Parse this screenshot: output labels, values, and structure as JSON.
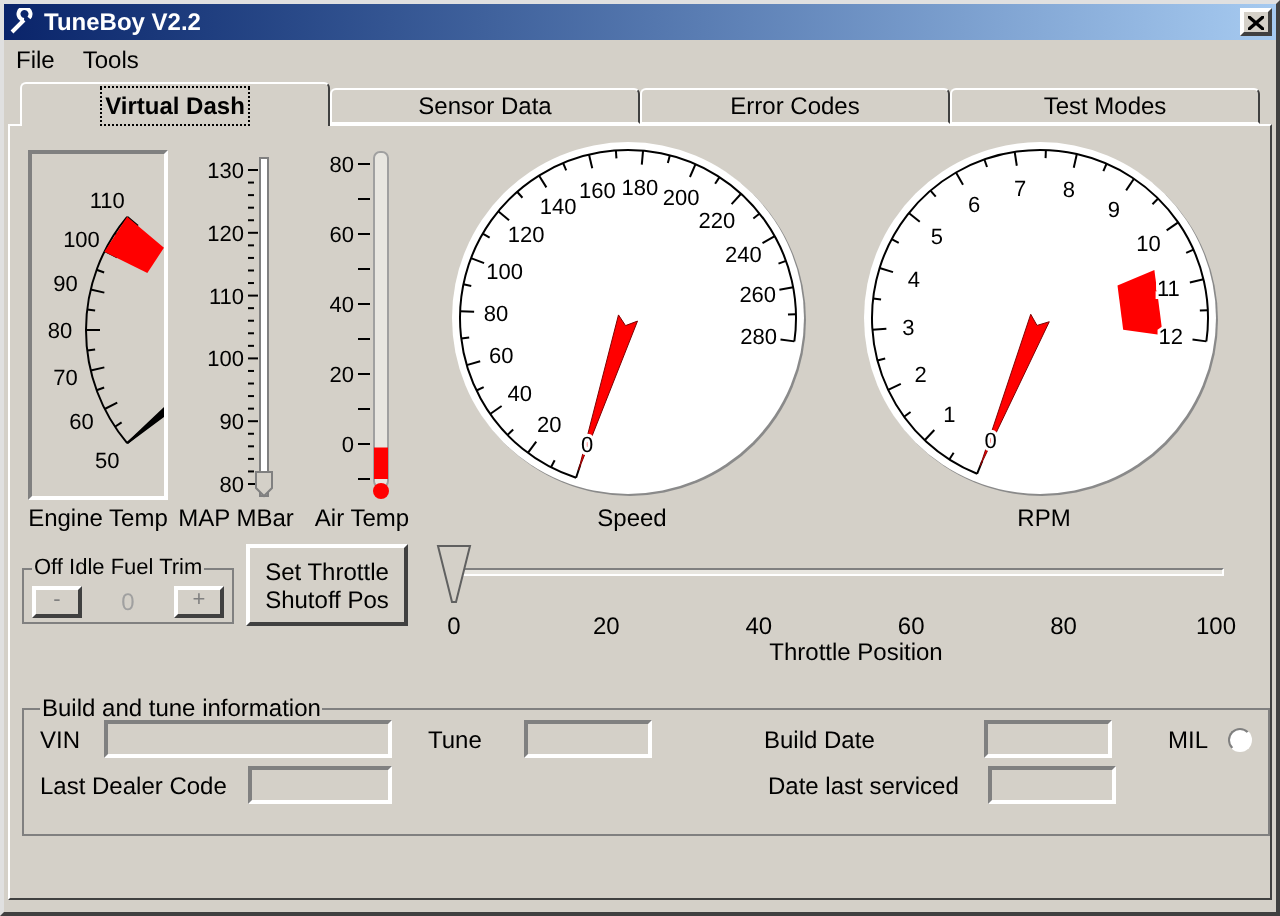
{
  "window": {
    "title": "TuneBoy V2.2"
  },
  "menu": [
    "File",
    "Tools"
  ],
  "tabs": [
    {
      "label": "Virtual Dash",
      "selected": true
    },
    {
      "label": "Sensor Data",
      "selected": false
    },
    {
      "label": "Error Codes",
      "selected": false
    },
    {
      "label": "Test Modes",
      "selected": false
    }
  ],
  "engine_temp": {
    "label": "Engine Temp",
    "ticks": [
      "110",
      "100",
      "90",
      "80",
      "70",
      "60",
      "50"
    ],
    "level": 0
  },
  "map": {
    "label": "MAP MBar",
    "ticks": [
      "130",
      "120",
      "110",
      "100",
      "90",
      "80"
    ],
    "level": 0
  },
  "air_temp": {
    "label": "Air Temp",
    "ticks": [
      "80",
      "60",
      "40",
      "20",
      "0"
    ],
    "level": 0.1
  },
  "speed": {
    "label": "Speed",
    "ticks": [
      "160",
      "180",
      "200",
      "140",
      "220",
      "120",
      "240",
      "100",
      "260",
      "80",
      "280",
      "60",
      "40",
      "20",
      "0"
    ]
  },
  "rpm": {
    "label": "RPM",
    "ticks": [
      "7",
      "8",
      "6",
      "9",
      "5",
      "10",
      "4",
      "11",
      "3",
      "12",
      "2",
      "1",
      "0"
    ]
  },
  "fuel_trim": {
    "title": "Off Idle Fuel Trim",
    "decrement": "-",
    "value": "0",
    "increment": "+",
    "disabled": true
  },
  "set_throttle_button": "Set Throttle Shutoff Pos",
  "throttle": {
    "label": "Throttle Position",
    "ticks": [
      "0",
      "20",
      "40",
      "60",
      "80",
      "100"
    ],
    "level": 0
  },
  "build_info": {
    "title": "Build and tune information",
    "fields": [
      {
        "label": "VIN"
      },
      {
        "label": "Tune"
      },
      {
        "label": "Build Date"
      },
      {
        "label": "Last Dealer Code"
      },
      {
        "label": "Date last serviced"
      }
    ],
    "mil": {
      "label": "MIL",
      "on": false
    }
  }
}
